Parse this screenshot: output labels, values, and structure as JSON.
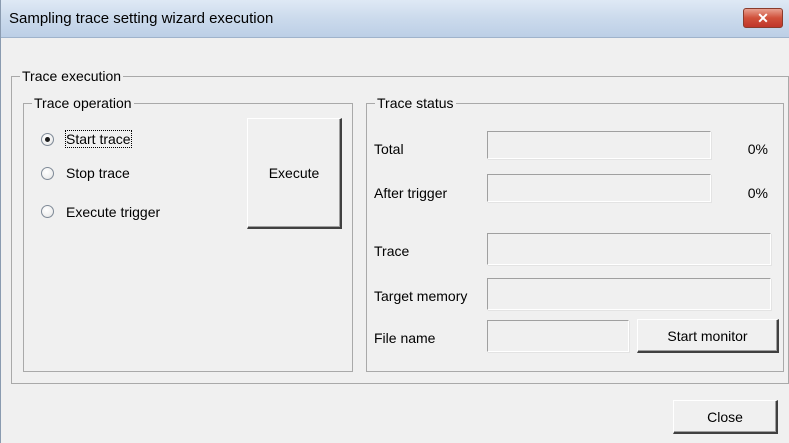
{
  "window": {
    "title": "Sampling trace setting wizard execution",
    "close_icon": "close-icon"
  },
  "trace_execution": {
    "group_label": "Trace execution",
    "operation": {
      "group_label": "Trace operation",
      "options": [
        {
          "label": "Start trace",
          "checked": true
        },
        {
          "label": "Stop trace",
          "checked": false
        },
        {
          "label": "Execute trigger",
          "checked": false
        }
      ],
      "execute_label": "Execute"
    },
    "status": {
      "group_label": "Trace status",
      "total_label": "Total",
      "total_percent": "0%",
      "total_progress": 0,
      "after_trigger_label": "After trigger",
      "after_trigger_percent": "0%",
      "after_trigger_progress": 0,
      "trace_label": "Trace",
      "trace_value": "",
      "target_memory_label": "Target memory",
      "target_memory_value": "",
      "file_name_label": "File name",
      "file_name_value": "",
      "start_monitor_label": "Start monitor"
    }
  },
  "footer": {
    "close_label": "Close"
  }
}
